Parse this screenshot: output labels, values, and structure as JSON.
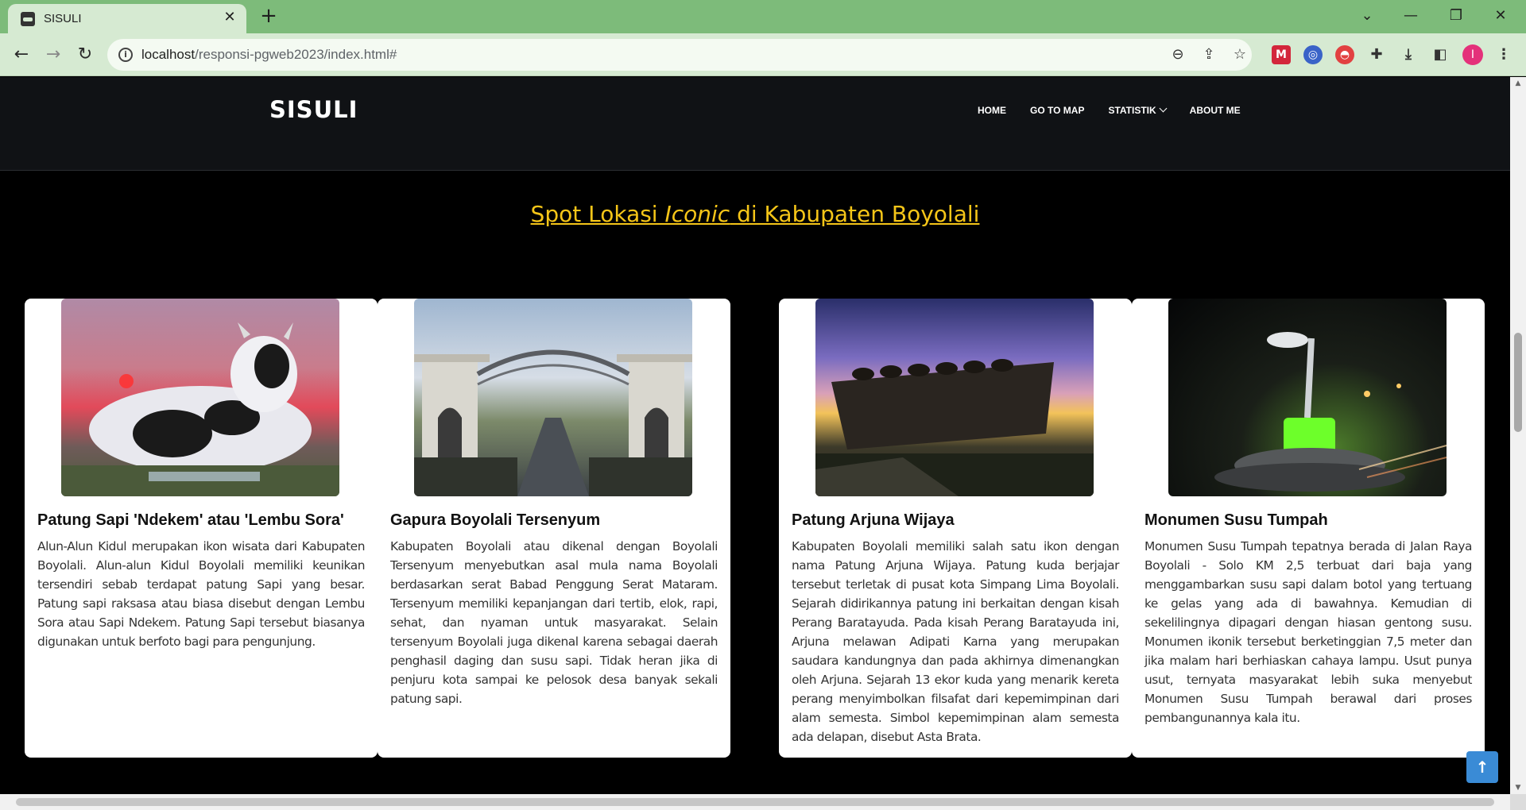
{
  "browser": {
    "tab_title": "SISULI",
    "tab_close": "✕",
    "new_tab": "+",
    "url_host": "localhost",
    "url_path": "/responsi-pgweb2023/index.html#",
    "profile_initial": "I"
  },
  "navbar": {
    "brand": "SISULI",
    "links": [
      "HOME",
      "GO TO MAP",
      "STATISTIK",
      "ABOUT ME"
    ]
  },
  "section": {
    "title_before": "Spot Lokasi ",
    "title_emphasis": "Iconic",
    "title_after": " di Kabupaten Boyolali"
  },
  "cards": [
    {
      "title": "Patung Sapi 'Ndekem' atau 'Lembu Sora'",
      "text": "Alun-Alun Kidul merupakan ikon wisata dari Kabupaten Boyolali. Alun-alun Kidul Boyolali memiliki keunikan tersendiri sebab terdapat patung Sapi yang besar. Patung sapi raksasa atau biasa disebut dengan Lembu Sora atau Sapi Ndekem. Patung Sapi tersebut biasanya digunakan untuk berfoto bagi para pengunjung."
    },
    {
      "title": "Gapura Boyolali Tersenyum",
      "text": "Kabupaten Boyolali atau dikenal dengan Boyolali Tersenyum menyebutkan asal mula nama Boyolali berdasarkan serat Babad Penggung Serat Mataram. Tersenyum memiliki kepanjangan dari tertib, elok, rapi, sehat, dan nyaman untuk masyarakat. Selain tersenyum Boyolali juga dikenal karena sebagai daerah penghasil daging dan susu sapi. Tidak heran jika di penjuru kota sampai ke pelosok desa banyak sekali patung sapi."
    },
    {
      "title": "Patung Arjuna Wijaya",
      "text": "Kabupaten Boyolali memiliki salah satu ikon dengan nama Patung Arjuna Wijaya. Patung kuda berjajar tersebut terletak di pusat kota Simpang Lima Boyolali. Sejarah didirikannya patung ini berkaitan dengan kisah Perang Baratayuda. Pada kisah Perang Baratayuda ini, Arjuna melawan Adipati Karna yang merupakan saudara kandungnya dan pada akhirnya dimenangkan oleh Arjuna. Sejarah 13 ekor kuda yang menarik kereta perang menyimbolkan filsafat dari kepemimpinan dari alam semesta. Simbol kepemimpinan alam semesta ada delapan, disebut Asta Brata."
    },
    {
      "title": "Monumen Susu Tumpah",
      "text": "Monumen Susu Tumpah tepatnya berada di Jalan Raya Boyolali - Solo KM 2,5 terbuat dari baja yang menggambarkan susu sapi dalam botol yang tertuang ke gelas yang ada di bawahnya. Kemudian di sekelilingnya dipagari dengan hiasan gentong susu. Monumen ikonik tersebut berketinggian 7,5 meter dan jika malam hari berhiaskan cahaya lampu. Usut punya usut, ternyata masyarakat lebih suka menyebut Monumen Susu Tumpah berawal dari proses pembangunannya kala itu."
    }
  ]
}
